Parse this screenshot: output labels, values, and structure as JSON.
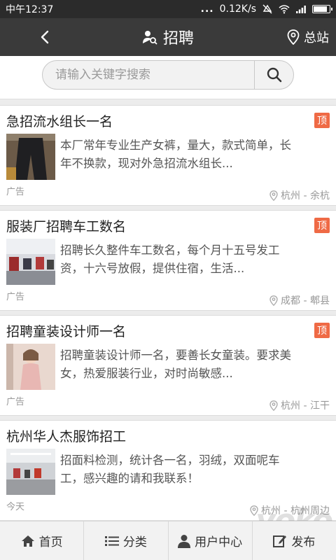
{
  "status_bar": {
    "time": "中午12:37",
    "dots": "...",
    "network_speed": "0.12K/s",
    "battery_level": 0.9
  },
  "header": {
    "title": "招聘",
    "location_label": "总站",
    "title_icon": "user-search-icon",
    "location_icon": "location-pin-icon",
    "back_icon": "chevron-left-icon"
  },
  "search": {
    "placeholder": "请输入关键字搜索",
    "value": ""
  },
  "listings": [
    {
      "title": "急招流水组长一名",
      "badge": "顶",
      "description": "本厂常年专业生产女裤，量大，款式简单，长年不换款，现对外急招流水组长...",
      "tag": "广告",
      "location": "杭州 - 余杭"
    },
    {
      "title": "服装厂招聘车工数名",
      "badge": "顶",
      "description": "招聘长久整件车工数名，每个月十五号发工资，十六号放假，提供住宿，生活...",
      "tag": "广告",
      "location": "成都 - 郫县"
    },
    {
      "title": "招聘童装设计师一名",
      "badge": "顶",
      "description": "招聘童装设计师一名，要善长女童装。要求美女，热爱服装行业，对时尚敏感...",
      "tag": "广告",
      "location": "杭州 - 江干"
    },
    {
      "title": "杭州华人杰服饰招工",
      "badge": "",
      "description": "招面料检测，统计各一名，羽绒，双面呢车工，感兴趣的请和我联系！",
      "tag": "今天",
      "location": "杭州 - 杭州周边"
    }
  ],
  "bottom_nav": {
    "home": "首页",
    "category": "分类",
    "user_center": "用户中心",
    "publish": "发布"
  },
  "watermark": "yoko",
  "colors": {
    "header_bg": "#3a3a3a",
    "badge_bg": "#ef6a45"
  }
}
